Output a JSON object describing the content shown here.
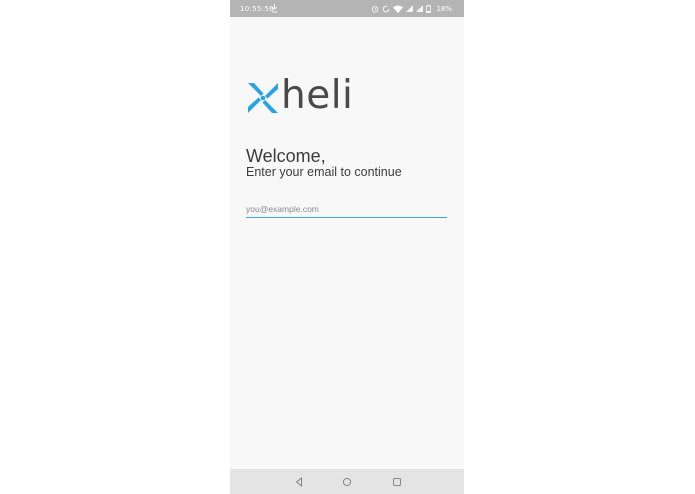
{
  "status_bar": {
    "time": "10:55:56",
    "battery": "18%",
    "icons": [
      "download-icon",
      "alarm-icon",
      "data-saver-icon",
      "wifi-icon",
      "signal-icon",
      "signal-icon",
      "battery-icon"
    ]
  },
  "brand": {
    "name": "heli",
    "accent_color": "#29a3e3"
  },
  "welcome": {
    "title": "Welcome,",
    "subtitle": "Enter your email to continue"
  },
  "email_field": {
    "placeholder": "you@example.com",
    "value": ""
  },
  "nav_bar": {
    "icons": [
      "back-icon",
      "home-icon",
      "recents-icon"
    ]
  }
}
